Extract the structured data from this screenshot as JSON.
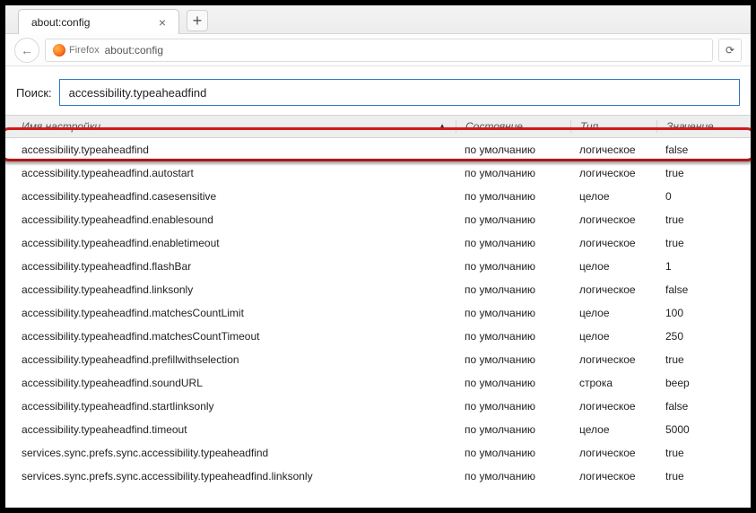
{
  "tab": {
    "title": "about:config",
    "close_glyph": "×",
    "new_glyph": "+"
  },
  "nav": {
    "back_glyph": "←",
    "reload_glyph": "⟳"
  },
  "urlbar": {
    "brand": "Firefox",
    "address": "about:config"
  },
  "search": {
    "label": "Поиск:",
    "value": "accessibility.typeaheadfind"
  },
  "headers": {
    "name": "Имя настройки",
    "state": "Состояние",
    "type": "Тип",
    "value": "Значение",
    "sort_glyph": "▲"
  },
  "rows": [
    {
      "name": "accessibility.typeaheadfind",
      "state": "по умолчанию",
      "type": "логическое",
      "value": "false"
    },
    {
      "name": "accessibility.typeaheadfind.autostart",
      "state": "по умолчанию",
      "type": "логическое",
      "value": "true"
    },
    {
      "name": "accessibility.typeaheadfind.casesensitive",
      "state": "по умолчанию",
      "type": "целое",
      "value": "0"
    },
    {
      "name": "accessibility.typeaheadfind.enablesound",
      "state": "по умолчанию",
      "type": "логическое",
      "value": "true"
    },
    {
      "name": "accessibility.typeaheadfind.enabletimeout",
      "state": "по умолчанию",
      "type": "логическое",
      "value": "true"
    },
    {
      "name": "accessibility.typeaheadfind.flashBar",
      "state": "по умолчанию",
      "type": "целое",
      "value": "1"
    },
    {
      "name": "accessibility.typeaheadfind.linksonly",
      "state": "по умолчанию",
      "type": "логическое",
      "value": "false"
    },
    {
      "name": "accessibility.typeaheadfind.matchesCountLimit",
      "state": "по умолчанию",
      "type": "целое",
      "value": "100"
    },
    {
      "name": "accessibility.typeaheadfind.matchesCountTimeout",
      "state": "по умолчанию",
      "type": "целое",
      "value": "250"
    },
    {
      "name": "accessibility.typeaheadfind.prefillwithselection",
      "state": "по умолчанию",
      "type": "логическое",
      "value": "true"
    },
    {
      "name": "accessibility.typeaheadfind.soundURL",
      "state": "по умолчанию",
      "type": "строка",
      "value": "beep"
    },
    {
      "name": "accessibility.typeaheadfind.startlinksonly",
      "state": "по умолчанию",
      "type": "логическое",
      "value": "false"
    },
    {
      "name": "accessibility.typeaheadfind.timeout",
      "state": "по умолчанию",
      "type": "целое",
      "value": "5000"
    },
    {
      "name": "services.sync.prefs.sync.accessibility.typeaheadfind",
      "state": "по умолчанию",
      "type": "логическое",
      "value": "true"
    },
    {
      "name": "services.sync.prefs.sync.accessibility.typeaheadfind.linksonly",
      "state": "по умолчанию",
      "type": "логическое",
      "value": "true"
    }
  ]
}
